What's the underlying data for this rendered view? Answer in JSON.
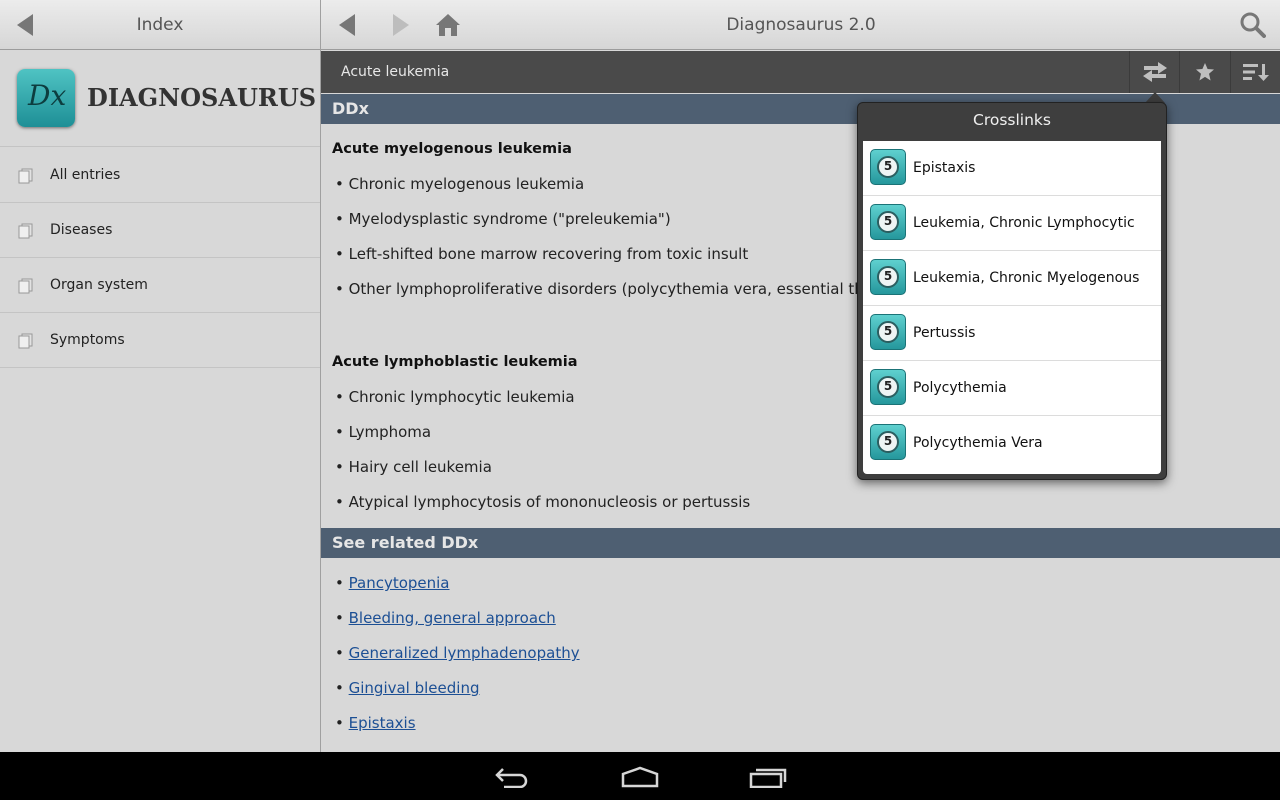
{
  "left_header": {
    "title": "Index"
  },
  "brand": {
    "logo_text": "Dx",
    "name": "DIAGNOSAURUS"
  },
  "nav": {
    "items": [
      {
        "label": "All entries"
      },
      {
        "label": "Diseases"
      },
      {
        "label": "Organ system"
      },
      {
        "label": "Symptoms"
      }
    ]
  },
  "main_header": {
    "title": "Diagnosaurus 2.0"
  },
  "subbar": {
    "title": "Acute leukemia"
  },
  "ddx": {
    "heading": "DDx",
    "groups": [
      {
        "title": "Acute myelogenous leukemia",
        "items": [
          "• Chronic myelogenous leukemia",
          "• Myelodysplastic syndrome (\"preleukemia\")",
          "• Left-shifted bone marrow recovering from toxic insult",
          "• Other lymphoproliferative disorders (polycythemia vera, essential throm"
        ]
      },
      {
        "title": "Acute lymphoblastic leukemia",
        "items": [
          "• Chronic lymphocytic leukemia",
          "• Lymphoma",
          "• Hairy cell leukemia",
          "• Atypical lymphocytosis of mononucleosis or pertussis"
        ]
      }
    ]
  },
  "related": {
    "heading": "See related DDx",
    "bullet": "• ",
    "links": [
      "Pancytopenia",
      "Bleeding, general approach",
      "Generalized lymphadenopathy",
      "Gingival bleeding",
      "Epistaxis"
    ]
  },
  "crosslinks": {
    "title": "Crosslinks",
    "icon_badge": "5",
    "items": [
      "Epistaxis",
      "Leukemia, Chronic Lymphocytic",
      "Leukemia, Chronic Myelogenous",
      "Pertussis",
      "Polycythemia",
      "Polycythemia Vera"
    ]
  },
  "colors": {
    "section_bar": "#4e5f72",
    "subbar": "#4a4a4a",
    "link": "#1c4f94",
    "accent_teal": "#2fa3a6"
  },
  "icons": {
    "left_back": "back-triangle-icon",
    "back": "back-triangle-icon",
    "forward": "forward-triangle-icon",
    "home": "home-icon",
    "search": "search-icon",
    "crosslinks": "swap-arrows-icon",
    "favorite": "star-icon",
    "sort": "sort-list-icon",
    "sys_back": "system-back-icon",
    "sys_home": "system-home-icon",
    "sys_recents": "system-recents-icon"
  }
}
